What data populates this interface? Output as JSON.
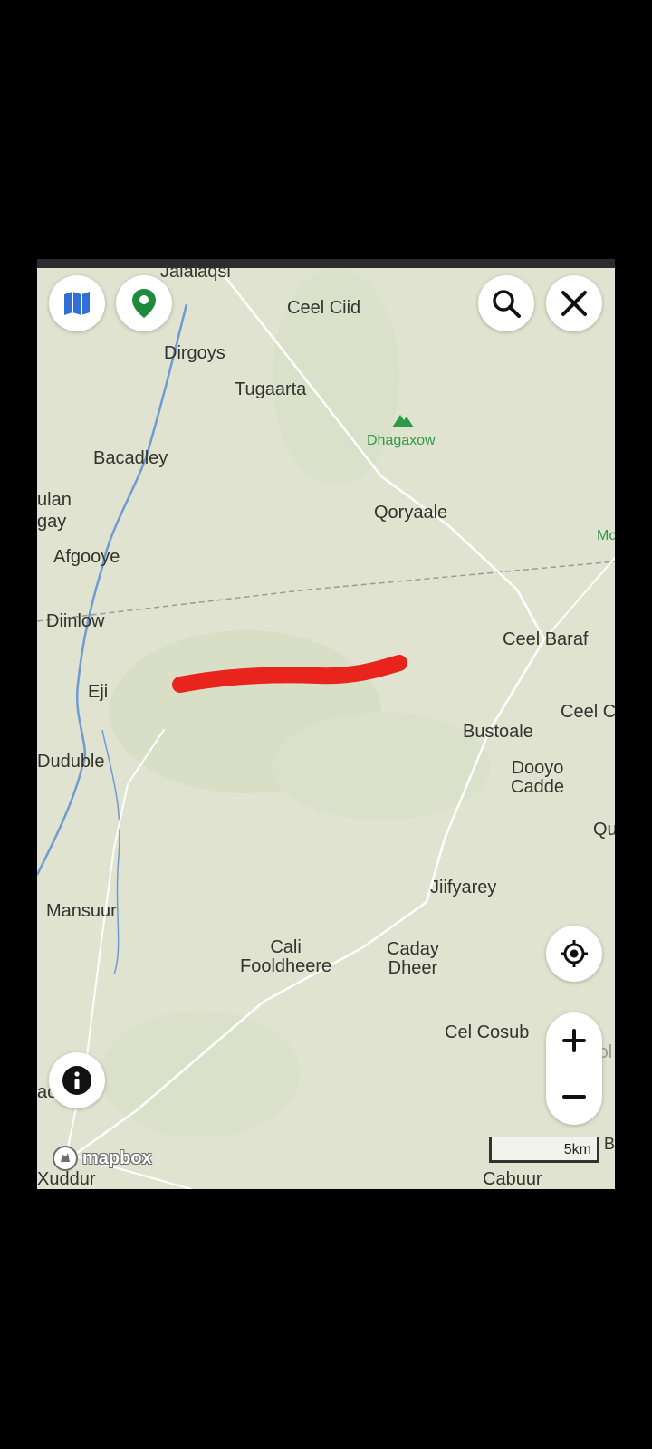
{
  "places": {
    "jalalaqsi": "Jalalaqsi",
    "ceel_ciid": "Ceel Ciid",
    "dirgoys": "Dirgoys",
    "tugaarta": "Tugaarta",
    "dhagaxow": "Dhagaxow",
    "bacadley": "Bacadley",
    "ulan": "ulan",
    "gay": "gay",
    "qoryaale": "Qoryaale",
    "mc": "Mc",
    "afgooye": "Afgooye",
    "diinlow": "Diinlow",
    "ceel_baraf": "Ceel Baraf",
    "eji": "Eji",
    "ceel_c": "Ceel C",
    "bustoale": "Bustoale",
    "duduble": "Duduble",
    "dooyo_cadde": "Dooyo\nCadde",
    "qu": "Qu",
    "jiifyarey": "Jiifyarey",
    "mansuur": "Mansuur",
    "cali_fooldheere": "Cali\nFooldheere",
    "caday_dheer": "Caday\nDheer",
    "cel_cosub": "Cel Cosub",
    "hool": "Hool",
    "ac": "ac",
    "xuddur": "Xuddur",
    "cabuur": "Cabuur",
    "b": "B"
  },
  "attribution": "mapbox",
  "scale_label": "5km",
  "colors": {
    "land": "#dfe3cf",
    "river": "#6f9bd4",
    "road": "#ffffff",
    "highlight": "#e8241d",
    "peak": "#2f9a4a",
    "pin": "#1e8a3c",
    "map_button": "#2f6fd6"
  },
  "icons": [
    "map-layers-icon",
    "location-pin-icon",
    "search-icon",
    "close-icon",
    "my-location-icon",
    "zoom-in-icon",
    "zoom-out-icon",
    "info-icon",
    "mountain-icon",
    "mapbox-logo-icon"
  ]
}
